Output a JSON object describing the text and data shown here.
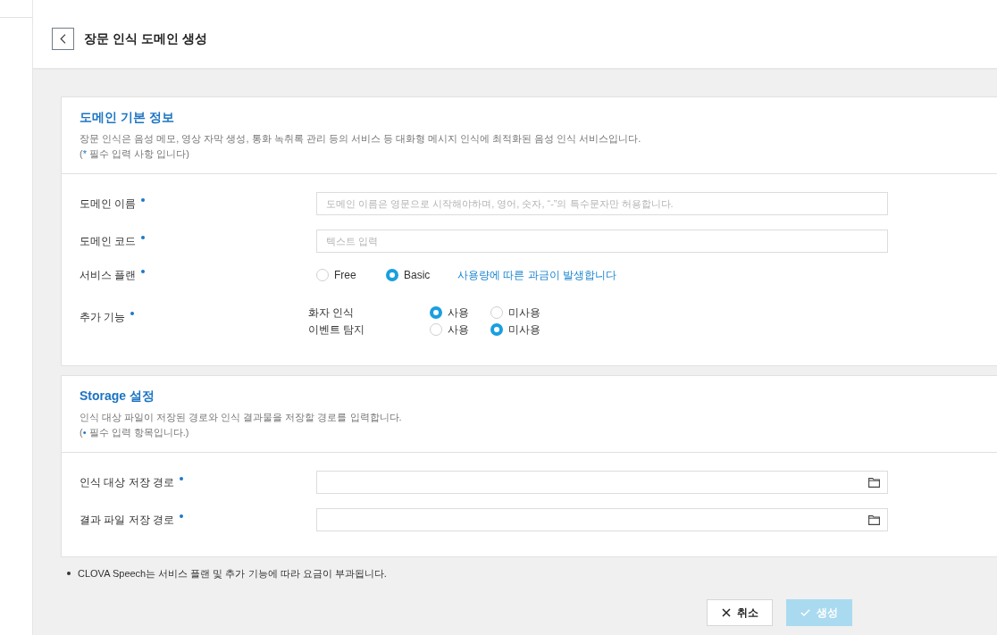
{
  "header": {
    "title": "장문 인식 도메인 생성"
  },
  "sections": [
    {
      "title": "도메인 기본 정보",
      "description": "장문 인식은 음성 메모, 영상 자막 생성, 통화 녹취록 관리 등의 서비스 등 대화형 메시지 인식에 최적화된 음성 인식 서비스입니다.",
      "note": {
        "open": "(",
        "mark": "*",
        "text": " 필수 입력 사항 입니다)"
      },
      "fields": [
        {
          "kind": "text",
          "label": "도메인 이름",
          "required": true,
          "placeholder": "도메인 이름은 영문으로 시작해야하며, 영어, 숫자, “-”의 특수문자만 허용합니다."
        },
        {
          "kind": "text",
          "label": "도메인 코드",
          "required": true,
          "placeholder": "텍스트 입력"
        },
        {
          "kind": "radio",
          "label": "서비스 플랜",
          "required": true,
          "options": [
            {
              "label": "Free",
              "selected": false
            },
            {
              "label": "Basic",
              "selected": true
            }
          ],
          "link": "사용량에 따른 과금이 발생합니다"
        },
        {
          "kind": "features",
          "label": "추가 기능",
          "required": true,
          "features": [
            {
              "name": "화자 인식",
              "options": [
                {
                  "label": "사용",
                  "selected": true
                },
                {
                  "label": "미사용",
                  "selected": false
                }
              ]
            },
            {
              "name": "이벤트 탐지",
              "options": [
                {
                  "label": "사용",
                  "selected": false
                },
                {
                  "label": "미사용",
                  "selected": true
                }
              ]
            }
          ]
        }
      ]
    },
    {
      "title": "Storage 설정",
      "description": "인식 대상 파일이 저장된 경로와 인식 결과물을 저장할 경로를 입력합니다.",
      "note": {
        "open": "(",
        "mark": "•",
        "text": " 필수 입력 항목입니다.)"
      },
      "fields": [
        {
          "kind": "path",
          "label": "인식 대상 저장 경로",
          "required": true
        },
        {
          "kind": "path",
          "label": "결과 파일 저장 경로",
          "required": true
        }
      ]
    }
  ],
  "notes": [
    "CLOVA Speech는 서비스 플랜 및 추가 기능에 따라 요금이 부과됩니다."
  ],
  "buttons": [
    {
      "kind": "cancel",
      "label": "취소",
      "disabled": false
    },
    {
      "kind": "submit",
      "label": "생성",
      "disabled": true
    }
  ]
}
